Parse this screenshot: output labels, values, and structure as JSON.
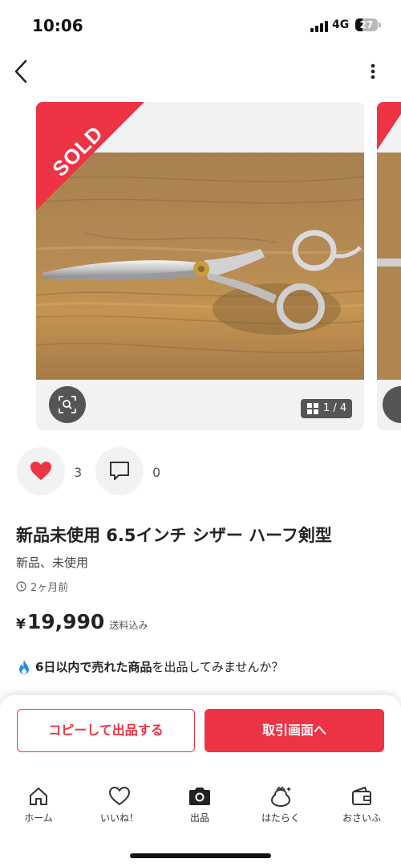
{
  "status_bar": {
    "time": "10:06",
    "network": "4G",
    "battery": "27"
  },
  "listing": {
    "sold_badge": "SOLD",
    "image_counter": "1 / 4",
    "likes": "3",
    "comments": "0",
    "title": "新品未使用 6.5インチ シザー ハーフ剣型",
    "condition": "新品、未使用",
    "posted": "2ヶ月前",
    "currency": "¥",
    "price": "19,990",
    "shipping": "送料込み"
  },
  "promo": {
    "highlight": "6日以内で売れた商品",
    "text": "を出品してみませんか？"
  },
  "actions": {
    "copy_label": "コピーして出品する",
    "trade_label": "取引画面へ"
  },
  "tabs": [
    {
      "label": "ホーム",
      "icon": "home-icon"
    },
    {
      "label": "いいね！",
      "icon": "heart-outline-icon"
    },
    {
      "label": "出品",
      "icon": "camera-icon"
    },
    {
      "label": "はたらく",
      "icon": "work-icon"
    },
    {
      "label": "おさいふ",
      "icon": "wallet-icon"
    }
  ],
  "colors": {
    "accent": "#ee3344",
    "like": "#ee3344"
  }
}
